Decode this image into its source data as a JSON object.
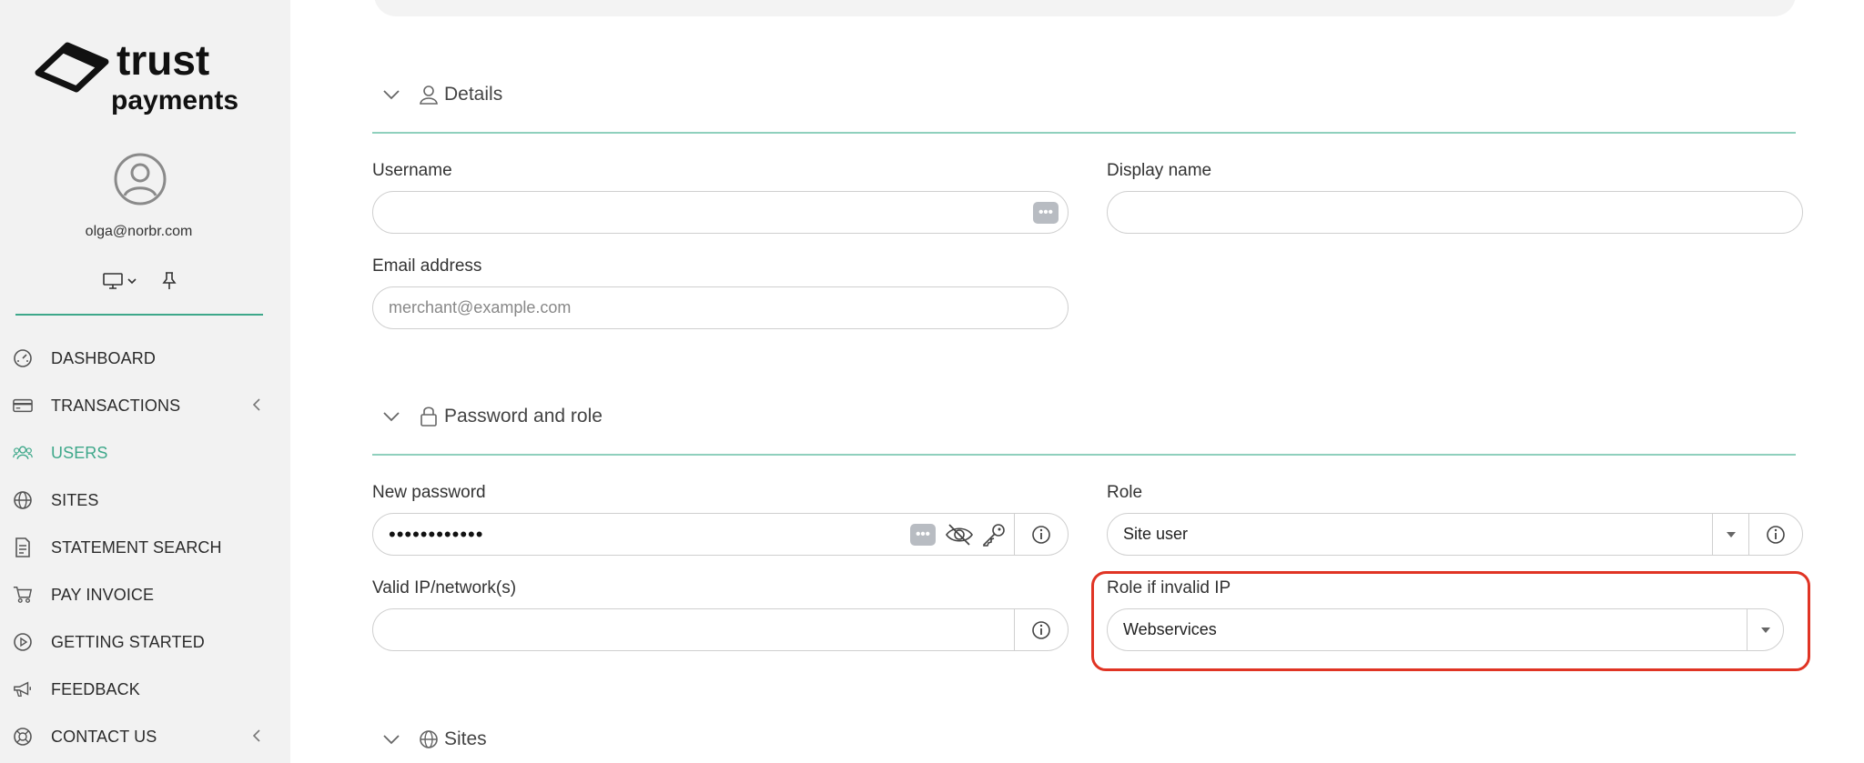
{
  "sidebar": {
    "logo_text": "trust payments",
    "user_email": "olga@norbr.com",
    "nav": [
      {
        "label": "DASHBOARD",
        "icon": "dashboard-gauge-icon",
        "has_chevron": false,
        "active": false
      },
      {
        "label": "TRANSACTIONS",
        "icon": "credit-card-icon",
        "has_chevron": true,
        "active": false
      },
      {
        "label": "USERS",
        "icon": "users-icon",
        "has_chevron": false,
        "active": true
      },
      {
        "label": "SITES",
        "icon": "globe-icon",
        "has_chevron": false,
        "active": false
      },
      {
        "label": "STATEMENT SEARCH",
        "icon": "document-icon",
        "has_chevron": false,
        "active": false
      },
      {
        "label": "PAY INVOICE",
        "icon": "cart-icon",
        "has_chevron": false,
        "active": false
      },
      {
        "label": "GETTING STARTED",
        "icon": "play-circle-icon",
        "has_chevron": false,
        "active": false
      },
      {
        "label": "FEEDBACK",
        "icon": "megaphone-icon",
        "has_chevron": false,
        "active": false
      },
      {
        "label": "CONTACT US",
        "icon": "lifebuoy-icon",
        "has_chevron": true,
        "active": false
      }
    ]
  },
  "details": {
    "title": "Details",
    "username_label": "Username",
    "username_value": "",
    "display_name_label": "Display name",
    "display_name_value": "",
    "email_label": "Email address",
    "email_placeholder": "merchant@example.com"
  },
  "password_role": {
    "title": "Password and role",
    "new_password_label": "New password",
    "new_password_value": "••••••••••••",
    "role_label": "Role",
    "role_value": "Site user",
    "valid_ip_label": "Valid IP/network(s)",
    "valid_ip_value": "",
    "role_invalid_ip_label": "Role if invalid IP",
    "role_invalid_ip_value": "Webservices"
  },
  "sites": {
    "title": "Sites"
  },
  "colors": {
    "accent": "#3ea88a",
    "highlight": "#e03424"
  }
}
